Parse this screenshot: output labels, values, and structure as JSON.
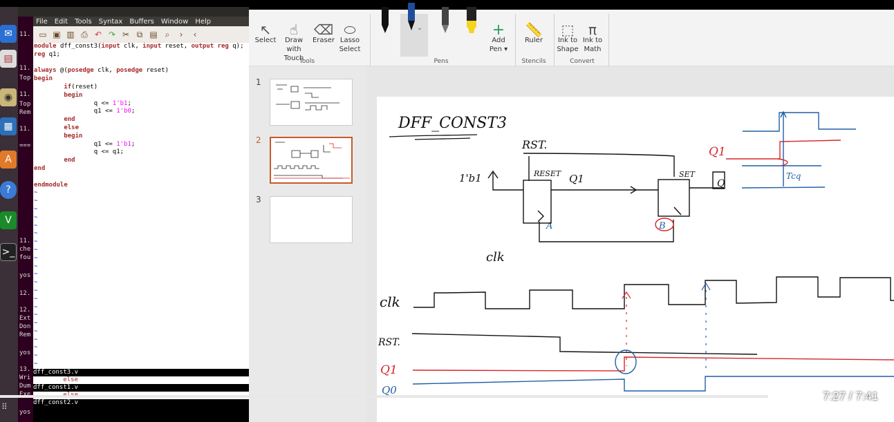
{
  "vim": {
    "menu": [
      "File",
      "Edit",
      "Tools",
      "Syntax",
      "Buffers",
      "Window",
      "Help"
    ],
    "code_lines": [
      [
        {
          "t": "module ",
          "c": "kw"
        },
        {
          "t": "dff_const3(",
          "c": ""
        },
        {
          "t": "input",
          "c": "kw"
        },
        {
          "t": " clk, ",
          "c": ""
        },
        {
          "t": "input",
          "c": "kw"
        },
        {
          "t": " reset, ",
          "c": ""
        },
        {
          "t": "output",
          "c": "kw"
        },
        {
          "t": " ",
          "c": ""
        },
        {
          "t": "reg",
          "c": "kw"
        },
        {
          "t": " q);",
          "c": ""
        }
      ],
      [
        {
          "t": "reg",
          "c": "kw"
        },
        {
          "t": " q1;",
          "c": ""
        }
      ],
      [],
      [
        {
          "t": "always",
          "c": "kw"
        },
        {
          "t": " @(",
          "c": ""
        },
        {
          "t": "posedge",
          "c": "kw"
        },
        {
          "t": " clk, ",
          "c": ""
        },
        {
          "t": "posedge",
          "c": "kw"
        },
        {
          "t": " reset)",
          "c": ""
        }
      ],
      [
        {
          "t": "begin",
          "c": "kw"
        }
      ],
      [
        {
          "t": "        if",
          "c": "kw"
        },
        {
          "t": "(reset)",
          "c": ""
        }
      ],
      [
        {
          "t": "        begin",
          "c": "kw"
        }
      ],
      [
        {
          "t": "                q <= ",
          "c": ""
        },
        {
          "t": "1'b1",
          "c": "num"
        },
        {
          "t": ";",
          "c": ""
        }
      ],
      [
        {
          "t": "                q1 <= ",
          "c": ""
        },
        {
          "t": "1'b0",
          "c": "num"
        },
        {
          "t": ";",
          "c": ""
        }
      ],
      [
        {
          "t": "        end",
          "c": "kw"
        }
      ],
      [
        {
          "t": "        else",
          "c": "kw"
        }
      ],
      [
        {
          "t": "        begin",
          "c": "kw"
        }
      ],
      [
        {
          "t": "                q1 <= ",
          "c": ""
        },
        {
          "t": "1'b1",
          "c": "num"
        },
        {
          "t": ";",
          "c": ""
        }
      ],
      [
        {
          "t": "                q <= q1;",
          "c": ""
        }
      ],
      [
        {
          "t": "        end",
          "c": "kw"
        }
      ],
      [
        {
          "t": "end",
          "c": "kw"
        }
      ],
      [],
      [
        {
          "t": "endmodule",
          "c": "kw"
        }
      ]
    ],
    "tilde_count": 22,
    "status": [
      {
        "text": "dff_const3.v",
        "style": "st-bar"
      },
      {
        "text": "        else",
        "style": "st-code"
      },
      {
        "text": "dff_const1.v",
        "style": "st-bar"
      },
      {
        "text": "        else",
        "style": "st-code"
      },
      {
        "text": "dff_const2.v",
        "style": "st-bar"
      }
    ]
  },
  "terminal_lines": [
    "11.",
    "11.",
    "Top",
    "11.",
    "Top",
    "Rem",
    "11.",
    "===",
    "11.",
    "che",
    "fou",
    "yos",
    "12.",
    "12.",
    "Ext",
    "Don",
    "Rem",
    "yos",
    "13.",
    "Wri",
    "Dum",
    "Exe",
    "yos"
  ],
  "ribbon": {
    "tools": [
      {
        "label1": "Select",
        "label2": "",
        "icon": "↖"
      },
      {
        "label1": "Draw with",
        "label2": "Touch",
        "icon": "☝"
      },
      {
        "label1": "Eraser",
        "label2": "",
        "icon": "⌫"
      },
      {
        "label1": "Lasso",
        "label2": "Select",
        "icon": "⬭"
      }
    ],
    "group_tools": "Tools",
    "group_pens": "Pens",
    "add_pen1": "Add",
    "add_pen2": "Pen",
    "ruler": "Ruler",
    "group_stencils": "Stencils",
    "ink_shape1": "Ink to",
    "ink_shape2": "Shape",
    "ink_math1": "Ink to",
    "ink_math2": "Math",
    "group_convert": "Convert"
  },
  "thumbs": [
    {
      "num": "1",
      "active": false
    },
    {
      "num": "2",
      "active": true
    },
    {
      "num": "3",
      "active": false
    }
  ],
  "slide": {
    "title": "DFF_CONST3",
    "rst": "RST.",
    "reset": "RESET",
    "set": "SET",
    "one_b1": "1'b1",
    "q1": "Q1",
    "q": "Q",
    "a": "A",
    "b": "B",
    "clk": "clk",
    "q1_right": "Q1",
    "tcq": "Tcq",
    "wave_clk": "clk",
    "wave_rst": "RST.",
    "wave_q1": "Q1",
    "wave_q": "Q0"
  },
  "player": {
    "time": "7:27 / 7:41",
    "progress": 0.969
  },
  "colors": {
    "ink": "#111111",
    "red": "#d7262b",
    "blue": "#1f5fa8",
    "thumb_active": "#c55a2a"
  }
}
